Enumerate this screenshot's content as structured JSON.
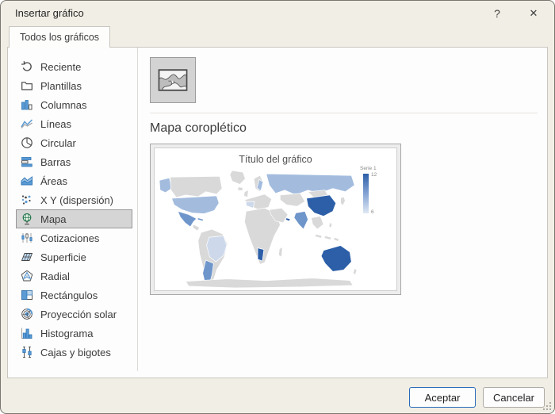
{
  "dialog": {
    "title": "Insertar gráfico",
    "help_label": "?",
    "close_label": "✕"
  },
  "tabs": [
    {
      "label": "Todos los gráficos",
      "active": true
    }
  ],
  "sidebar": {
    "items": [
      {
        "key": "reciente",
        "label": "Reciente",
        "icon": "recent-icon",
        "selected": false
      },
      {
        "key": "plantillas",
        "label": "Plantillas",
        "icon": "folder-icon",
        "selected": false
      },
      {
        "key": "columnas",
        "label": "Columnas",
        "icon": "column-chart-icon",
        "selected": false
      },
      {
        "key": "lineas",
        "label": "Líneas",
        "icon": "line-chart-icon",
        "selected": false
      },
      {
        "key": "circular",
        "label": "Circular",
        "icon": "pie-chart-icon",
        "selected": false
      },
      {
        "key": "barras",
        "label": "Barras",
        "icon": "bar-chart-icon",
        "selected": false
      },
      {
        "key": "areas",
        "label": "Áreas",
        "icon": "area-chart-icon",
        "selected": false
      },
      {
        "key": "xy-dispersion",
        "label": "X Y (dispersión)",
        "icon": "scatter-chart-icon",
        "selected": false
      },
      {
        "key": "mapa",
        "label": "Mapa",
        "icon": "map-globe-icon",
        "selected": true
      },
      {
        "key": "cotizaciones",
        "label": "Cotizaciones",
        "icon": "stock-chart-icon",
        "selected": false
      },
      {
        "key": "superficie",
        "label": "Superficie",
        "icon": "surface-chart-icon",
        "selected": false
      },
      {
        "key": "radial",
        "label": "Radial",
        "icon": "radar-chart-icon",
        "selected": false
      },
      {
        "key": "rectangulos",
        "label": "Rectángulos",
        "icon": "treemap-chart-icon",
        "selected": false
      },
      {
        "key": "proyeccion-solar",
        "label": "Proyección solar",
        "icon": "sunburst-chart-icon",
        "selected": false
      },
      {
        "key": "histograma",
        "label": "Histograma",
        "icon": "histogram-chart-icon",
        "selected": false
      },
      {
        "key": "cajas-y-bigotes",
        "label": "Cajas y bigotes",
        "icon": "boxwhisker-chart-icon",
        "selected": false
      }
    ]
  },
  "main": {
    "heading": "Mapa coroplético",
    "preview": {
      "chart_title": "Título del gráfico",
      "legend_title": "Serie 1",
      "legend_max": "12",
      "legend_min": "6"
    }
  },
  "map_regions": [
    {
      "id": "alaska",
      "level": "level2"
    },
    {
      "id": "usa",
      "level": "level2"
    },
    {
      "id": "mexico",
      "level": "level3"
    },
    {
      "id": "cuba",
      "level": "level3"
    },
    {
      "id": "brazil",
      "level": "level1"
    },
    {
      "id": "argentina",
      "level": "level3"
    },
    {
      "id": "sweden",
      "level": "level2"
    },
    {
      "id": "france",
      "level": "level1"
    },
    {
      "id": "namibia",
      "level": "level4"
    },
    {
      "id": "russia",
      "level": "level2"
    },
    {
      "id": "uae",
      "level": "level4"
    },
    {
      "id": "china",
      "level": "level4"
    },
    {
      "id": "india",
      "level": "level3"
    },
    {
      "id": "australia",
      "level": "level4"
    }
  ],
  "footer": {
    "ok_label": "Aceptar",
    "cancel_label": "Cancelar"
  },
  "colors": {
    "accent_blue": "#2a6bb7",
    "selection_bg": "#d5d5d5",
    "map": {
      "none": "#d9d9d9",
      "level1": "#cdd9eb",
      "level2": "#a3bcde",
      "level3": "#6f96cb",
      "level4": "#2c5fa8"
    }
  }
}
